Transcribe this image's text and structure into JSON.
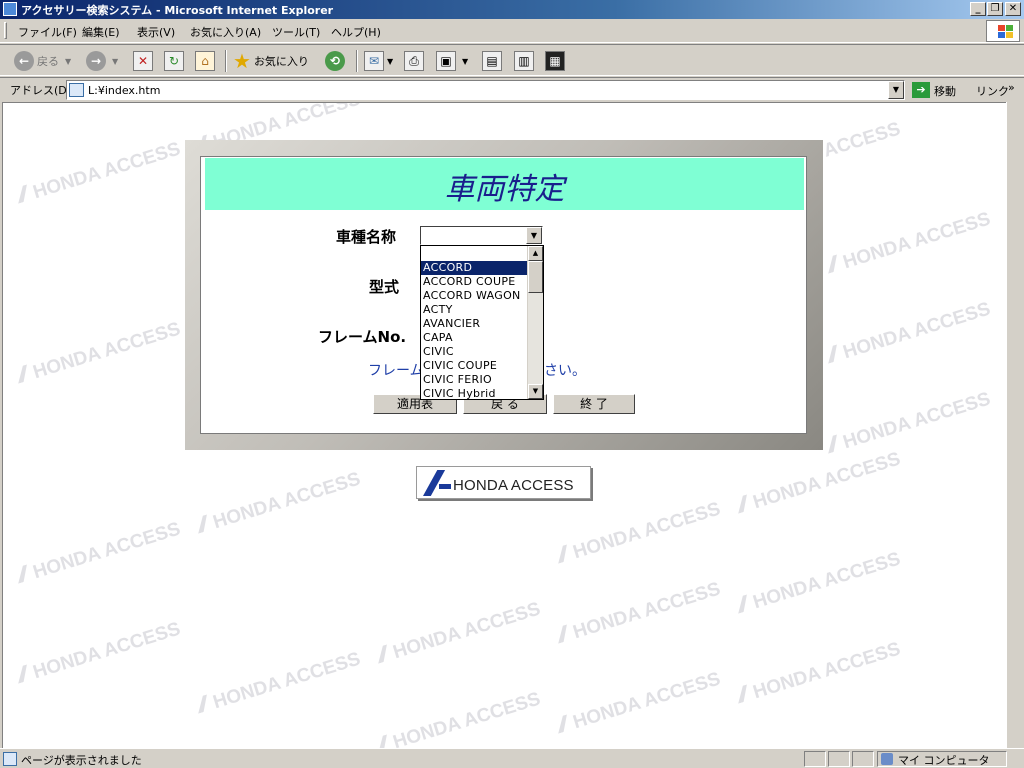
{
  "window": {
    "title": "アクセサリー検索システム - Microsoft Internet Explorer"
  },
  "menu": [
    "ファイル(F)",
    "編集(E)",
    "表示(V)",
    "お気に入り(A)",
    "ツール(T)",
    "ヘルプ(H)"
  ],
  "toolbar": {
    "back_label": "戻る",
    "favorites_label": "お気に入り"
  },
  "address": {
    "label": "アドレス(D)",
    "value": "L:¥index.htm",
    "go_label": "移動",
    "links_label": "リンク"
  },
  "page": {
    "heading": "車両特定",
    "fields": {
      "model_name": "車種名称",
      "type": "型式",
      "frame_no": "フレームNo."
    },
    "note": "フレームNo.を入力してください。",
    "dropdown_options": [
      "ACCORD",
      "ACCORD COUPE",
      "ACCORD WAGON",
      "ACTY",
      "AVANCIER",
      "CAPA",
      "CIVIC",
      "CIVIC COUPE",
      "CIVIC FERIO",
      "CIVIC Hybrid"
    ],
    "dropdown_selected": "ACCORD",
    "buttons": {
      "apply_table": "適用表",
      "back": "戻 る",
      "exit": "終 了"
    },
    "logo_text": "HONDA ACCESS",
    "watermark_text": "HONDA ACCESS",
    "heading_bg": "#7fffd4",
    "heading_color": "#1a1e8c"
  },
  "status": {
    "text": "ページが表示されました",
    "zone": "マイ コンピュータ"
  }
}
